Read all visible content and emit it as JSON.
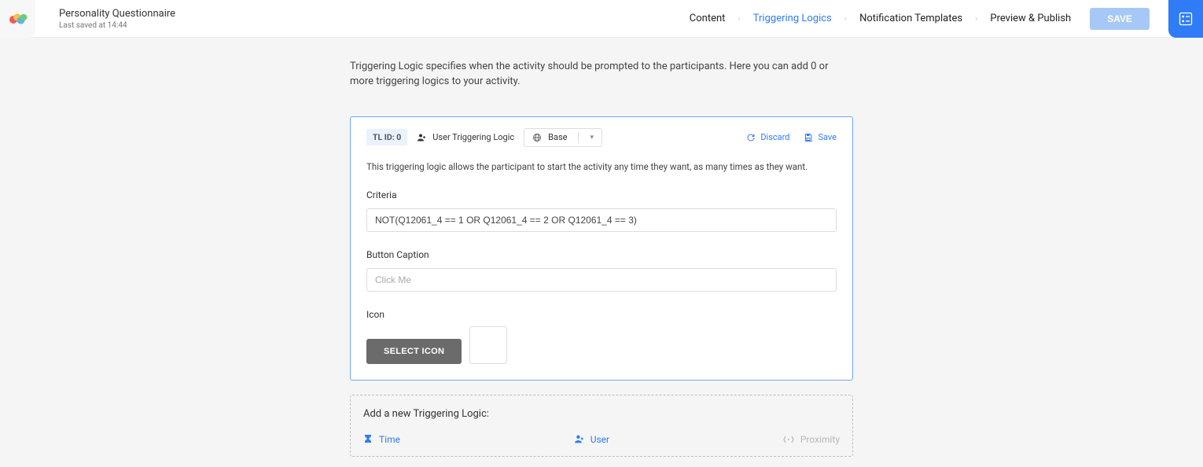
{
  "header": {
    "title": "Personality Questionnaire",
    "last_saved": "Last saved at 14:44",
    "nav": {
      "content": "Content",
      "triggering": "Triggering Logics",
      "notification": "Notification Templates",
      "preview": "Preview & Publish"
    },
    "save_label": "SAVE"
  },
  "intro": "Triggering Logic specifies when the activity should be prompted to the participants. Here you can add 0 or more triggering logics to your activity.",
  "card": {
    "tl_id": "TL ID: 0",
    "type_label": "User Triggering Logic",
    "base_label": "Base",
    "discard_label": "Discard",
    "save_label": "Save",
    "description": "This triggering logic allows the participant to start the activity any time they want, as many times as they want.",
    "criteria_label": "Criteria",
    "criteria_value": "NOT(Q12061_4 == 1 OR Q12061_4 == 2 OR Q12061_4 == 3)",
    "button_caption_label": "Button Caption",
    "button_caption_placeholder": "Click Me",
    "icon_label": "Icon",
    "select_icon_label": "SELECT ICON"
  },
  "add_panel": {
    "title": "Add a new Triggering Logic:",
    "time_label": "Time",
    "user_label": "User",
    "proximity_label": "Proximity"
  }
}
